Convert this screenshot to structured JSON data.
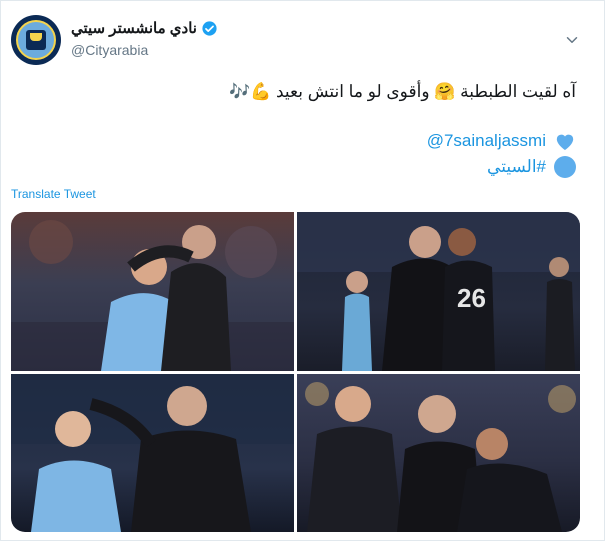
{
  "tweet": {
    "display_name": "نادي مانشستر سيتي",
    "handle": "@Cityarabia",
    "text_line1": "آه لقيت الطبطبة 🤗 وأقوى لو ما انتش بعيد 💪🎶",
    "mention": "@7sainaljassmi",
    "hashtag": "#السيتي",
    "translate_label": "Translate Tweet"
  },
  "colors": {
    "link": "#1b95e0",
    "verified": "#1da1f2",
    "city_blue": "#6cabdd"
  },
  "icons": {
    "verified": "verified-badge-icon",
    "chevron": "chevron-down-icon",
    "heart": "blue-heart-icon",
    "circle": "blue-circle-icon"
  }
}
